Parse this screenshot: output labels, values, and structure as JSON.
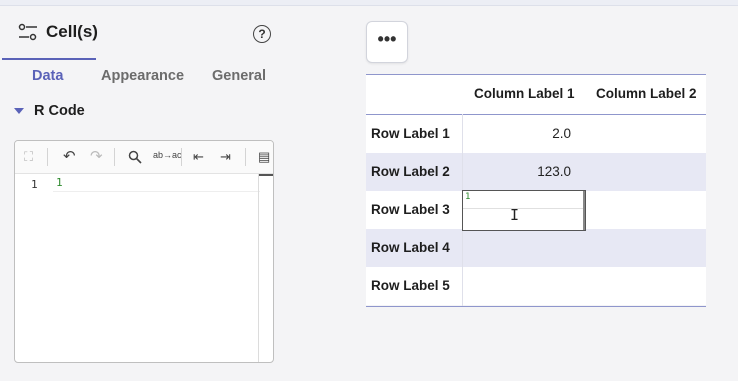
{
  "panel": {
    "title": "Cell(s)",
    "help_icon_text": "?",
    "tabs": [
      {
        "label": "Data",
        "active": true
      },
      {
        "label": "Appearance",
        "active": false
      },
      {
        "label": "General",
        "active": false
      }
    ],
    "section_label": "R Code"
  },
  "editor": {
    "toolbar": {
      "expand": "⛶",
      "undo": "↶",
      "redo": "↷",
      "search": "🔍",
      "replace": "ab→ac",
      "outdent": "⇤",
      "indent": "⇥",
      "comment": "▤"
    },
    "line_numbers": [
      "1"
    ],
    "lines": [
      "1"
    ]
  },
  "table": {
    "menu_label": "•••",
    "columns": [
      "Column Label 1",
      "Column Label 2"
    ],
    "rows": [
      {
        "label": "Row Label 1",
        "col1": "2.0",
        "col2": ""
      },
      {
        "label": "Row Label 2",
        "col1": "123.0",
        "col2": ""
      },
      {
        "label": "Row Label 3",
        "col1": "",
        "col2": ""
      },
      {
        "label": "Row Label 4",
        "col1": "",
        "col2": ""
      },
      {
        "label": "Row Label 5",
        "col1": "",
        "col2": ""
      }
    ],
    "editing_cell": {
      "line_number": "1",
      "value": ""
    }
  },
  "colors": {
    "accent": "#5a62b8",
    "alt_row": "#e7e8f4",
    "code_green": "#2f8a2f"
  }
}
